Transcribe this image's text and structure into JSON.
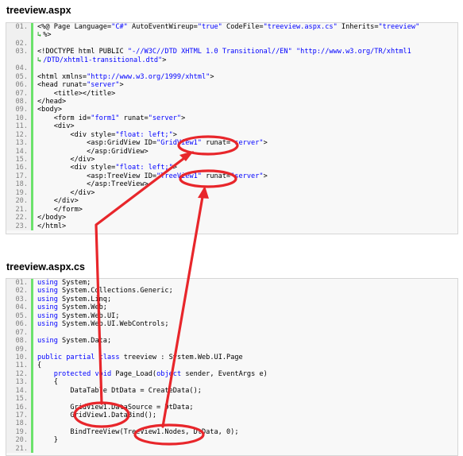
{
  "sections": {
    "aspx_title": "treeview.aspx",
    "cs_title": "treeview.aspx.cs"
  },
  "colors": {
    "keyword": "#0000ff",
    "line_number": "#808080",
    "gutter_bar": "#6ce26c",
    "annotation": "#e8262b"
  },
  "icons": {
    "continuation": "wrap-arrow-icon"
  },
  "aspx_lines": [
    {
      "num": "01.",
      "tokens": [
        [
          "plain",
          "<%@ Page Language="
        ],
        [
          "str",
          "\"C#\""
        ],
        [
          "plain",
          " AutoEventWireup="
        ],
        [
          "str",
          "\"true\""
        ],
        [
          "plain",
          " CodeFile="
        ],
        [
          "str",
          "\"treeview.aspx.cs\""
        ],
        [
          "plain",
          " Inherits="
        ],
        [
          "str",
          "\"treeview\""
        ]
      ]
    },
    {
      "num": "",
      "cont": true,
      "tokens": [
        [
          "plain",
          "%>"
        ]
      ]
    },
    {
      "num": "02.",
      "tokens": []
    },
    {
      "num": "03.",
      "tokens": [
        [
          "plain",
          "<!DOCTYPE html PUBLIC "
        ],
        [
          "str",
          "\"-//W3C//DTD XHTML 1.0 Transitional//EN\""
        ],
        [
          "plain",
          " "
        ],
        [
          "str",
          "\"http://www.w3.org/TR/xhtml1"
        ]
      ]
    },
    {
      "num": "",
      "cont": true,
      "tokens": [
        [
          "str",
          "/DTD/xhtml1-transitional.dtd\""
        ],
        [
          "plain",
          ">"
        ]
      ]
    },
    {
      "num": "04.",
      "tokens": []
    },
    {
      "num": "05.",
      "tokens": [
        [
          "plain",
          "<html xmlns="
        ],
        [
          "str",
          "\"http://www.w3.org/1999/xhtml\""
        ],
        [
          "plain",
          ">"
        ]
      ]
    },
    {
      "num": "06.",
      "tokens": [
        [
          "plain",
          "<head runat="
        ],
        [
          "str",
          "\"server\""
        ],
        [
          "plain",
          ">"
        ]
      ]
    },
    {
      "num": "07.",
      "tokens": [
        [
          "plain",
          "    <title></title>"
        ]
      ]
    },
    {
      "num": "08.",
      "tokens": [
        [
          "plain",
          "</head>"
        ]
      ]
    },
    {
      "num": "09.",
      "tokens": [
        [
          "plain",
          "<body>"
        ]
      ]
    },
    {
      "num": "10.",
      "tokens": [
        [
          "plain",
          "    <form id="
        ],
        [
          "str",
          "\"form1\""
        ],
        [
          "plain",
          " runat="
        ],
        [
          "str",
          "\"server\""
        ],
        [
          "plain",
          ">"
        ]
      ]
    },
    {
      "num": "11.",
      "tokens": [
        [
          "plain",
          "    <div>"
        ]
      ]
    },
    {
      "num": "12.",
      "tokens": [
        [
          "plain",
          "        <div style="
        ],
        [
          "str",
          "\"float: left;\""
        ],
        [
          "plain",
          ">"
        ]
      ]
    },
    {
      "num": "13.",
      "tokens": [
        [
          "plain",
          "            <asp:GridView ID="
        ],
        [
          "str",
          "\"GridView1\""
        ],
        [
          "plain",
          " runat="
        ],
        [
          "str",
          "\"server\""
        ],
        [
          "plain",
          ">"
        ]
      ]
    },
    {
      "num": "14.",
      "tokens": [
        [
          "plain",
          "            </asp:GridView>"
        ]
      ]
    },
    {
      "num": "15.",
      "tokens": [
        [
          "plain",
          "        </div>"
        ]
      ]
    },
    {
      "num": "16.",
      "tokens": [
        [
          "plain",
          "        <div style="
        ],
        [
          "str",
          "\"float: left;\""
        ],
        [
          "plain",
          ">"
        ]
      ]
    },
    {
      "num": "17.",
      "tokens": [
        [
          "plain",
          "            <asp:TreeView ID="
        ],
        [
          "str",
          "\"TreeView1\""
        ],
        [
          "plain",
          " runat="
        ],
        [
          "str",
          "\"server\""
        ],
        [
          "plain",
          ">"
        ]
      ]
    },
    {
      "num": "18.",
      "tokens": [
        [
          "plain",
          "            </asp:TreeView>"
        ]
      ]
    },
    {
      "num": "19.",
      "tokens": [
        [
          "plain",
          "        </div>"
        ]
      ]
    },
    {
      "num": "20.",
      "tokens": [
        [
          "plain",
          "    </div>"
        ]
      ]
    },
    {
      "num": "21.",
      "tokens": [
        [
          "plain",
          "    </form>"
        ]
      ]
    },
    {
      "num": "22.",
      "tokens": [
        [
          "plain",
          "</body>"
        ]
      ]
    },
    {
      "num": "23.",
      "tokens": [
        [
          "plain",
          "</html>"
        ]
      ]
    }
  ],
  "cs_lines": [
    {
      "num": "01.",
      "tokens": [
        [
          "kw",
          "using"
        ],
        [
          "plain",
          " System;"
        ]
      ]
    },
    {
      "num": "02.",
      "tokens": [
        [
          "kw",
          "using"
        ],
        [
          "plain",
          " System.Collections.Generic;"
        ]
      ]
    },
    {
      "num": "03.",
      "tokens": [
        [
          "kw",
          "using"
        ],
        [
          "plain",
          " System.Linq;"
        ]
      ]
    },
    {
      "num": "04.",
      "tokens": [
        [
          "kw",
          "using"
        ],
        [
          "plain",
          " System.Web;"
        ]
      ]
    },
    {
      "num": "05.",
      "tokens": [
        [
          "kw",
          "using"
        ],
        [
          "plain",
          " System.Web.UI;"
        ]
      ]
    },
    {
      "num": "06.",
      "tokens": [
        [
          "kw",
          "using"
        ],
        [
          "plain",
          " System.Web.UI.WebControls;"
        ]
      ]
    },
    {
      "num": "07.",
      "tokens": []
    },
    {
      "num": "08.",
      "tokens": [
        [
          "kw",
          "using"
        ],
        [
          "plain",
          " System.Data;"
        ]
      ]
    },
    {
      "num": "09.",
      "tokens": []
    },
    {
      "num": "10.",
      "tokens": [
        [
          "kw",
          "public"
        ],
        [
          "plain",
          " "
        ],
        [
          "kw",
          "partial"
        ],
        [
          "plain",
          " "
        ],
        [
          "kw",
          "class"
        ],
        [
          "plain",
          " treeview : System.Web.UI.Page"
        ]
      ]
    },
    {
      "num": "11.",
      "tokens": [
        [
          "plain",
          "{"
        ]
      ]
    },
    {
      "num": "12.",
      "tokens": [
        [
          "plain",
          "    "
        ],
        [
          "kw",
          "protected"
        ],
        [
          "plain",
          " "
        ],
        [
          "kw",
          "void"
        ],
        [
          "plain",
          " Page_Load("
        ],
        [
          "kw",
          "object"
        ],
        [
          "plain",
          " sender, EventArgs e)"
        ]
      ]
    },
    {
      "num": "13.",
      "tokens": [
        [
          "plain",
          "    {"
        ]
      ]
    },
    {
      "num": "14.",
      "tokens": [
        [
          "plain",
          "        DataTable DtData = CreateData();"
        ]
      ]
    },
    {
      "num": "15.",
      "tokens": []
    },
    {
      "num": "16.",
      "tokens": [
        [
          "plain",
          "        GridView1.DataSource = DtData;"
        ]
      ]
    },
    {
      "num": "17.",
      "tokens": [
        [
          "plain",
          "        GridView1.DataBind();"
        ]
      ]
    },
    {
      "num": "18.",
      "tokens": []
    },
    {
      "num": "19.",
      "tokens": [
        [
          "plain",
          "        BindTreeView(TreeView1.Nodes, DtData, 0);"
        ]
      ]
    },
    {
      "num": "20.",
      "tokens": [
        [
          "plain",
          "    }"
        ]
      ]
    },
    {
      "num": "21.",
      "tokens": []
    }
  ]
}
